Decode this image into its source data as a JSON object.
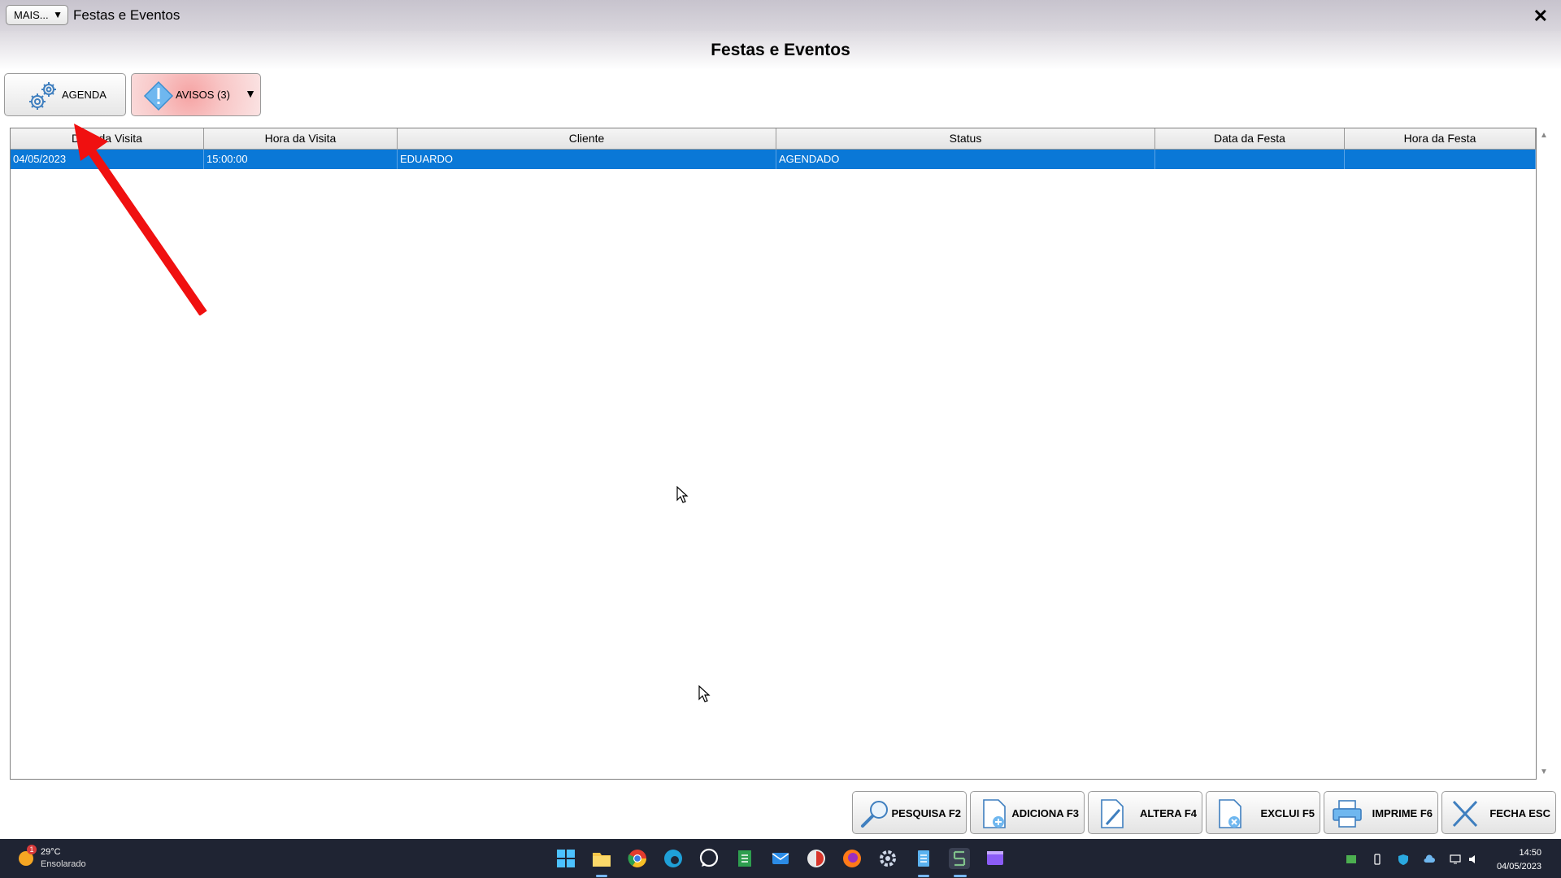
{
  "window": {
    "more_button": "MAIS...",
    "more_arrow": "▼",
    "title": "Festas e Eventos",
    "close": "✕"
  },
  "page": {
    "heading": "Festas e Eventos"
  },
  "toolbar": {
    "agenda_label": "AGENDA",
    "avisos_label": "AVISOS (3)",
    "avisos_dropdown": "▼"
  },
  "table": {
    "columns": [
      "Data da Visita",
      "Hora da Visita",
      "Cliente",
      "Status",
      "Data da Festa",
      "Hora da Festa"
    ],
    "rows": [
      {
        "data_visita": "04/05/2023",
        "hora_visita": "15:00:00",
        "cliente": "EDUARDO",
        "status": "AGENDADO",
        "data_festa": "",
        "hora_festa": ""
      }
    ],
    "selected_row_color": "#0a78d7"
  },
  "actions": {
    "pesquisa": "PESQUISA F2",
    "adiciona": "ADICIONA F3",
    "altera": "ALTERA F4",
    "exclui": "EXCLUI F5",
    "imprime": "IMPRIME F6",
    "fecha": "FECHA ESC"
  },
  "taskbar": {
    "weather_badge": "1",
    "temperature": "29°C",
    "condition": "Ensolarado",
    "time": "14:50",
    "date": "04/05/2023",
    "apps": [
      "windows-start",
      "file-explorer",
      "chrome",
      "edge",
      "whatsapp",
      "sheets",
      "mail",
      "app-red",
      "firefox",
      "settings",
      "notepad",
      "active-app",
      "media"
    ]
  },
  "annotation": {
    "arrow_color": "#f01010"
  }
}
